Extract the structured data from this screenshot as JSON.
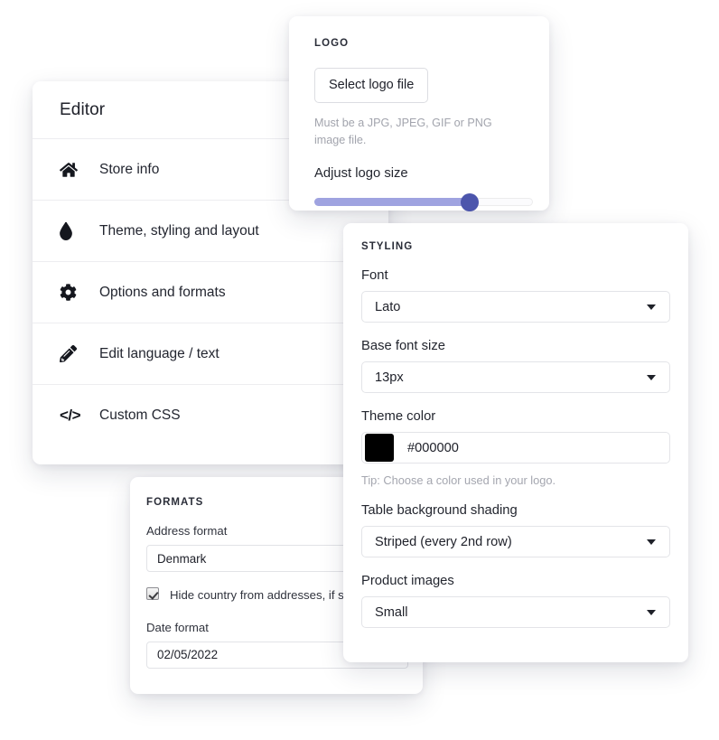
{
  "editor": {
    "title": "Editor",
    "items": [
      {
        "label": "Store info",
        "icon": "home-icon"
      },
      {
        "label": "Theme, styling and layout",
        "icon": "droplet-icon"
      },
      {
        "label": "Options and formats",
        "icon": "gear-icon"
      },
      {
        "label": "Edit language / text",
        "icon": "pencil-icon"
      },
      {
        "label": "Custom CSS",
        "icon": "code-icon"
      }
    ]
  },
  "logo": {
    "heading": "LOGO",
    "select_button": "Select logo file",
    "hint": "Must be a JPG, JPEG, GIF or PNG image file.",
    "slider_label": "Adjust logo size",
    "slider_value": 73,
    "slider_fill_color": "#9fa3e0",
    "slider_thumb_color": "#4c55ac"
  },
  "formats": {
    "heading": "FORMATS",
    "address_format_label": "Address format",
    "address_format_value": "Denmark",
    "hide_country_label": "Hide country from addresses, if same country",
    "hide_country_checked": true,
    "date_format_label": "Date format",
    "date_format_value": "02/05/2022"
  },
  "styling": {
    "heading": "STYLING",
    "font_label": "Font",
    "font_value": "Lato",
    "base_font_size_label": "Base font size",
    "base_font_size_value": "13px",
    "theme_color_label": "Theme color",
    "theme_color_value": "#000000",
    "theme_color_tip": "Tip: Choose a color used in your logo.",
    "table_shading_label": "Table background shading",
    "table_shading_value": "Striped (every 2nd row)",
    "product_images_label": "Product images",
    "product_images_value": "Small"
  }
}
